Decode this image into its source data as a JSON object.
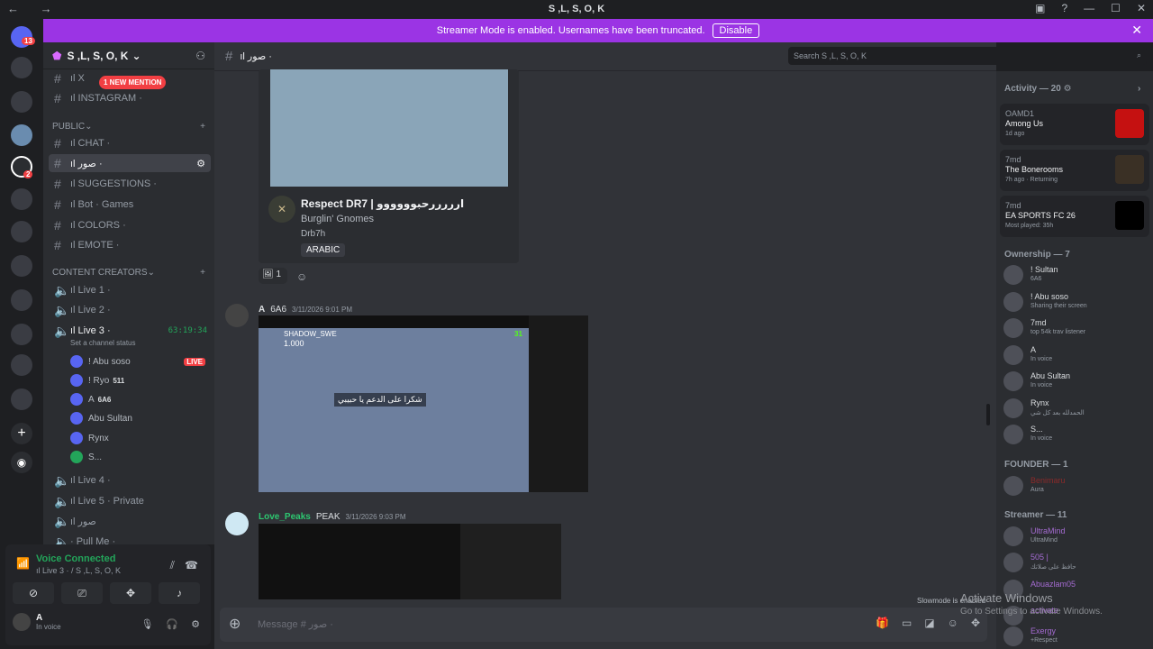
{
  "titlebar": {
    "title": "S ,L, S, O, K"
  },
  "banner": {
    "text": "Streamer Mode is enabled. Usernames have been truncated.",
    "button": "Disable"
  },
  "guilds": {
    "home_badge": "13",
    "dm_badge": "2"
  },
  "server": {
    "name": "S ,L, S, O, K"
  },
  "sidebar": {
    "mention_pill": "1 NEW MENTION",
    "top_channels": [
      "ıl X",
      "ıl INSTAGRAM ·"
    ],
    "public_label": "PUBLIC",
    "public_channels": [
      "ıl CHAT ·",
      "ıl صور ·",
      "ıl SUGGESTIONS ·",
      "ıl Bot · Games",
      "ıl COLORS ·",
      "ıl EMOTE ·"
    ],
    "content_label": "CONTENT CREATORS",
    "voice_channels": [
      "ıl Live 1 ·",
      "ıl Live 2 ·",
      "ıl Live 3 ·",
      "ıl Live 4 ·",
      "ıl Live 5 · Private",
      "ıl صور",
      "· Pull Me ·"
    ],
    "live_timer": "63:19:34",
    "channel_status": "Set a channel status",
    "voice_users": [
      {
        "name": "! Abu soso",
        "tag": "LIVE"
      },
      {
        "name": "! Ryo",
        "tag": "511"
      },
      {
        "name": "A",
        "tag": "6A6"
      },
      {
        "name": "Abu Sultan",
        "tag": ""
      },
      {
        "name": "Rynx",
        "tag": ""
      },
      {
        "name": "S...",
        "tag": ""
      }
    ]
  },
  "panel": {
    "connected": "Voice Connected",
    "location": "ıl Live 3 · / S ,L, S, O, K",
    "user": "A",
    "status": "In voice"
  },
  "channel": {
    "name": "ıl صور ·",
    "search_placeholder": "Search S ,L, S, O, K"
  },
  "embed": {
    "title": "Respect DR7 | ارررررحبوووووو",
    "artist": "Burglin' Gnomes",
    "sub": "Drb7h",
    "tag": "ARABIC"
  },
  "reaction": {
    "count": "1"
  },
  "messages": [
    {
      "author": "A",
      "badge": "6A6",
      "time": "3/11/2026 9:01 PM"
    },
    {
      "author": "Love_Peaks",
      "badge": "PEAK",
      "time": "3/11/2026 9:03 PM"
    }
  ],
  "stream": {
    "streamer": "SHADOW_SWE",
    "count": "1.000",
    "caption": "شكرا على الدعم يا حبيبي",
    "viewers": "31"
  },
  "composer": {
    "placeholder": "Message # صور ·",
    "slowmode": "Slowmode is enabled"
  },
  "activity": {
    "header": "Activity — 20",
    "items": [
      {
        "user": "OAMD1",
        "game": "Among Us",
        "sub": "1d ago"
      },
      {
        "user": "7md",
        "game": "The Bonerooms",
        "sub": "7h ago · Returning"
      },
      {
        "user": "7md",
        "game": "EA SPORTS FC 26",
        "sub": "Most played: 35h"
      }
    ]
  },
  "members": {
    "ownership_header": "Ownership — 7",
    "ownership": [
      {
        "name": "! Sultan",
        "status": "6A6"
      },
      {
        "name": "! Abu soso",
        "status": "Sharing their screen"
      },
      {
        "name": "7md",
        "status": "top 54k trav listener"
      },
      {
        "name": "A",
        "status": "In voice"
      },
      {
        "name": "Abu Sultan",
        "status": "In voice"
      },
      {
        "name": "Rynx",
        "status": "الحمدلله بعد كل شي"
      },
      {
        "name": "S...",
        "status": "In voice"
      }
    ],
    "founder_header": "FOUNDER — 1",
    "founder": [
      {
        "name": "Benimaru",
        "status": "Aura"
      }
    ],
    "streamer_header": "Streamer — 11",
    "streamer": [
      {
        "name": "UltraMind",
        "status": "UltraMind"
      },
      {
        "name": "505 |",
        "status": "حافظ علی صلاتك"
      },
      {
        "name": "Abuazlam05",
        "status": ""
      },
      {
        "name": "activate",
        "status": ""
      },
      {
        "name": "Exergy",
        "status": "+Respect"
      }
    ]
  },
  "watermark": {
    "line1": "Activate Windows",
    "line2": "Go to Settings to activate Windows."
  }
}
